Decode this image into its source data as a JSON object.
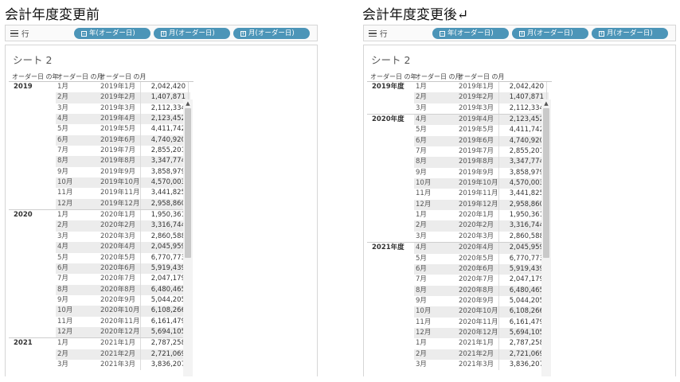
{
  "left": {
    "heading": "会計年度変更前",
    "shelf": {
      "label": "行",
      "pills": [
        "年(オーダー日)",
        "月(オーダー日)",
        "月(オーダー日)"
      ]
    },
    "sheet_title": "シート 2",
    "columns": [
      "オーダー日 の年",
      "オーダー日 の月",
      "オーダー日 の月"
    ],
    "rows": [
      {
        "year": "2019",
        "month": "1月",
        "ym": "2019年1月",
        "value": "2,042,420"
      },
      {
        "year": "",
        "month": "2月",
        "ym": "2019年2月",
        "value": "1,407,871"
      },
      {
        "year": "",
        "month": "3月",
        "ym": "2019年3月",
        "value": "2,112,334"
      },
      {
        "year": "",
        "month": "4月",
        "ym": "2019年4月",
        "value": "2,123,452"
      },
      {
        "year": "",
        "month": "5月",
        "ym": "2019年5月",
        "value": "4,411,742"
      },
      {
        "year": "",
        "month": "6月",
        "ym": "2019年6月",
        "value": "4,740,920"
      },
      {
        "year": "",
        "month": "7月",
        "ym": "2019年7月",
        "value": "2,855,201"
      },
      {
        "year": "",
        "month": "8月",
        "ym": "2019年8月",
        "value": "3,347,774"
      },
      {
        "year": "",
        "month": "9月",
        "ym": "2019年9月",
        "value": "3,858,979"
      },
      {
        "year": "",
        "month": "10月",
        "ym": "2019年10月",
        "value": "4,570,003"
      },
      {
        "year": "",
        "month": "11月",
        "ym": "2019年11月",
        "value": "3,441,825"
      },
      {
        "year": "",
        "month": "12月",
        "ym": "2019年12月",
        "value": "2,958,860"
      },
      {
        "year": "2020",
        "month": "1月",
        "ym": "2020年1月",
        "value": "1,950,361"
      },
      {
        "year": "",
        "month": "2月",
        "ym": "2020年2月",
        "value": "3,316,744"
      },
      {
        "year": "",
        "month": "3月",
        "ym": "2020年3月",
        "value": "2,860,588"
      },
      {
        "year": "",
        "month": "4月",
        "ym": "2020年4月",
        "value": "2,045,959"
      },
      {
        "year": "",
        "month": "5月",
        "ym": "2020年5月",
        "value": "6,770,773"
      },
      {
        "year": "",
        "month": "6月",
        "ym": "2020年6月",
        "value": "5,919,439"
      },
      {
        "year": "",
        "month": "7月",
        "ym": "2020年7月",
        "value": "2,047,179"
      },
      {
        "year": "",
        "month": "8月",
        "ym": "2020年8月",
        "value": "6,480,465"
      },
      {
        "year": "",
        "month": "9月",
        "ym": "2020年9月",
        "value": "5,044,205"
      },
      {
        "year": "",
        "month": "10月",
        "ym": "2020年10月",
        "value": "6,108,266"
      },
      {
        "year": "",
        "month": "11月",
        "ym": "2020年11月",
        "value": "6,161,479"
      },
      {
        "year": "",
        "month": "12月",
        "ym": "2020年12月",
        "value": "5,694,105"
      },
      {
        "year": "2021",
        "month": "1月",
        "ym": "2021年1月",
        "value": "2,787,258"
      },
      {
        "year": "",
        "month": "2月",
        "ym": "2021年2月",
        "value": "2,721,069"
      },
      {
        "year": "",
        "month": "3月",
        "ym": "2021年3月",
        "value": "3,836,207"
      }
    ]
  },
  "right": {
    "heading": "会計年度変更後↵",
    "shelf": {
      "label": "行",
      "pills": [
        "年(オーダー日)",
        "月(オーダー日)",
        "月(オーダー日)"
      ]
    },
    "sheet_title": "シート 2",
    "columns": [
      "オーダー日 の年",
      "オーダー日 の月",
      "オーダー日 の月"
    ],
    "rows": [
      {
        "year": "2019年度",
        "month": "1月",
        "ym": "2019年1月",
        "value": "2,042,420"
      },
      {
        "year": "",
        "month": "2月",
        "ym": "2019年2月",
        "value": "1,407,871"
      },
      {
        "year": "",
        "month": "3月",
        "ym": "2019年3月",
        "value": "2,112,334"
      },
      {
        "year": "2020年度",
        "month": "4月",
        "ym": "2019年4月",
        "value": "2,123,452"
      },
      {
        "year": "",
        "month": "5月",
        "ym": "2019年5月",
        "value": "4,411,742"
      },
      {
        "year": "",
        "month": "6月",
        "ym": "2019年6月",
        "value": "4,740,920"
      },
      {
        "year": "",
        "month": "7月",
        "ym": "2019年7月",
        "value": "2,855,201"
      },
      {
        "year": "",
        "month": "8月",
        "ym": "2019年8月",
        "value": "3,347,774"
      },
      {
        "year": "",
        "month": "9月",
        "ym": "2019年9月",
        "value": "3,858,979"
      },
      {
        "year": "",
        "month": "10月",
        "ym": "2019年10月",
        "value": "4,570,003"
      },
      {
        "year": "",
        "month": "11月",
        "ym": "2019年11月",
        "value": "3,441,825"
      },
      {
        "year": "",
        "month": "12月",
        "ym": "2019年12月",
        "value": "2,958,860"
      },
      {
        "year": "",
        "month": "1月",
        "ym": "2020年1月",
        "value": "1,950,361"
      },
      {
        "year": "",
        "month": "2月",
        "ym": "2020年2月",
        "value": "3,316,744"
      },
      {
        "year": "",
        "month": "3月",
        "ym": "2020年3月",
        "value": "2,860,588"
      },
      {
        "year": "2021年度",
        "month": "4月",
        "ym": "2020年4月",
        "value": "2,045,959"
      },
      {
        "year": "",
        "month": "5月",
        "ym": "2020年5月",
        "value": "6,770,773"
      },
      {
        "year": "",
        "month": "6月",
        "ym": "2020年6月",
        "value": "5,919,439"
      },
      {
        "year": "",
        "month": "7月",
        "ym": "2020年7月",
        "value": "2,047,179"
      },
      {
        "year": "",
        "month": "8月",
        "ym": "2020年8月",
        "value": "6,480,465"
      },
      {
        "year": "",
        "month": "9月",
        "ym": "2020年9月",
        "value": "5,044,205"
      },
      {
        "year": "",
        "month": "10月",
        "ym": "2020年10月",
        "value": "6,108,266"
      },
      {
        "year": "",
        "month": "11月",
        "ym": "2020年11月",
        "value": "6,161,479"
      },
      {
        "year": "",
        "month": "12月",
        "ym": "2020年12月",
        "value": "5,694,105"
      },
      {
        "year": "",
        "month": "1月",
        "ym": "2021年1月",
        "value": "2,787,258"
      },
      {
        "year": "",
        "month": "2月",
        "ym": "2021年2月",
        "value": "2,721,069"
      },
      {
        "year": "",
        "month": "3月",
        "ym": "2021年3月",
        "value": "3,836,207"
      }
    ]
  },
  "colors": {
    "pill": "#4c95b8",
    "shade": "#ececec",
    "border": "#d6d6d6"
  },
  "icons": [
    "rows-icon",
    "date-box-icon",
    "scroll-up-icon",
    "scroll-down-icon"
  ]
}
